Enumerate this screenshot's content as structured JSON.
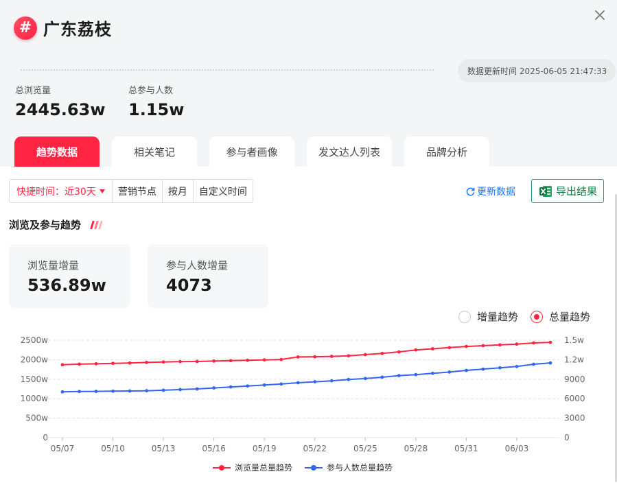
{
  "header": {
    "title": "广东荔枝",
    "hash_symbol": "#",
    "update_time": "数据更新时间 2025-06-05 21:47:33"
  },
  "stats": [
    {
      "label": "总浏览量",
      "value": "2445.63w"
    },
    {
      "label": "总参与人数",
      "value": "1.15w"
    }
  ],
  "tabs": [
    {
      "label": "趋势数据",
      "active": true
    },
    {
      "label": "相关笔记",
      "active": false
    },
    {
      "label": "参与者画像",
      "active": false
    },
    {
      "label": "发文达人列表",
      "active": false
    },
    {
      "label": "品牌分析",
      "active": false
    }
  ],
  "filters": {
    "quick": "快捷时间：近30天",
    "items": [
      "营销节点",
      "按月",
      "自定义时间"
    ]
  },
  "actions": {
    "refresh": "更新数据",
    "export": "导出结果"
  },
  "section": {
    "title": "浏览及参与趋势"
  },
  "cards": [
    {
      "label": "浏览量增量",
      "value": "536.89w"
    },
    {
      "label": "参与人数增量",
      "value": "4073"
    }
  ],
  "radios": [
    {
      "label": "增量趋势",
      "checked": false
    },
    {
      "label": "总量趋势",
      "checked": true
    }
  ],
  "colors": {
    "accent": "#ff2442",
    "views": "#ff2442",
    "participants": "#3366ee",
    "excel": "#107c41",
    "link": "#1677ff"
  },
  "chart_data": {
    "type": "line",
    "x": [
      "05/07",
      "05/08",
      "05/09",
      "05/10",
      "05/11",
      "05/12",
      "05/13",
      "05/14",
      "05/15",
      "05/16",
      "05/17",
      "05/18",
      "05/19",
      "05/20",
      "05/21",
      "05/22",
      "05/23",
      "05/24",
      "05/25",
      "05/26",
      "05/27",
      "05/28",
      "05/29",
      "05/30",
      "05/31",
      "06/01",
      "06/02",
      "06/03",
      "06/04",
      "06/05"
    ],
    "x_tick_labels": [
      "05/07",
      "05/10",
      "05/13",
      "05/16",
      "05/19",
      "05/22",
      "05/25",
      "05/28",
      "05/31",
      "06/03"
    ],
    "series": [
      {
        "name": "浏览量总量趋势",
        "axis": "left",
        "color": "#ff2442",
        "values": [
          1870,
          1885,
          1895,
          1905,
          1915,
          1930,
          1940,
          1950,
          1955,
          1965,
          1975,
          1985,
          1995,
          2005,
          2070,
          2075,
          2085,
          2100,
          2130,
          2160,
          2200,
          2250,
          2280,
          2310,
          2340,
          2360,
          2380,
          2400,
          2430,
          2445.63
        ]
      },
      {
        "name": "参与人数总量趋势",
        "axis": "right",
        "color": "#3366ee",
        "values": [
          7050,
          7100,
          7120,
          7150,
          7180,
          7220,
          7300,
          7400,
          7500,
          7650,
          7800,
          7950,
          8100,
          8250,
          8450,
          8600,
          8750,
          8950,
          9100,
          9300,
          9550,
          9700,
          9900,
          10100,
          10350,
          10550,
          10750,
          10950,
          11300,
          11500
        ]
      }
    ],
    "y_left": {
      "min": 0,
      "max": 2500,
      "ticks": [
        "0",
        "500w",
        "1000w",
        "1500w",
        "2000w",
        "2500w"
      ]
    },
    "y_right": {
      "min": 0,
      "max": 15000,
      "ticks": [
        "0",
        "3000",
        "6000",
        "9000",
        "1.2w",
        "1.5w"
      ]
    },
    "grid": true,
    "legend_position": "bottom-center"
  }
}
